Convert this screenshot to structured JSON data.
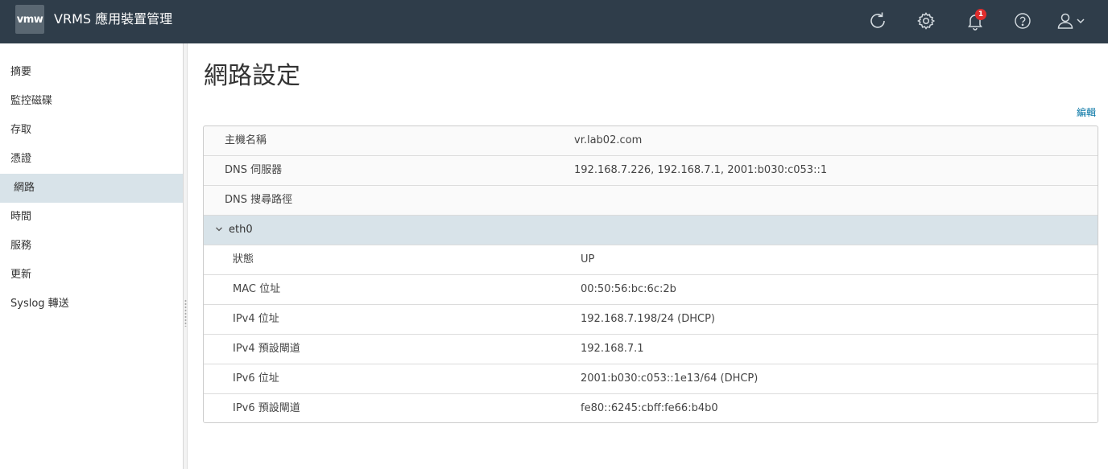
{
  "header": {
    "logo_text": "vmw",
    "title": "VRMS 應用裝置管理",
    "notification_count": "1",
    "icons": [
      "refresh-icon",
      "gear-icon",
      "bell-icon",
      "help-icon",
      "user-icon"
    ]
  },
  "sidebar": {
    "items": [
      {
        "label": "摘要"
      },
      {
        "label": "監控磁碟"
      },
      {
        "label": "存取"
      },
      {
        "label": "憑證"
      },
      {
        "label": "網路",
        "active": true
      },
      {
        "label": "時間"
      },
      {
        "label": "服務"
      },
      {
        "label": "更新"
      },
      {
        "label": "Syslog 轉送"
      }
    ]
  },
  "main": {
    "title": "網路設定",
    "edit_label": "編輯",
    "general": [
      {
        "key": "主機名稱",
        "value": "vr.lab02.com"
      },
      {
        "key": "DNS 伺服器",
        "value": "192.168.7.226, 192.168.7.1, 2001:b030:c053::1"
      },
      {
        "key": "DNS 搜尋路徑",
        "value": ""
      }
    ],
    "interface": {
      "name": "eth0",
      "rows": [
        {
          "key": "狀態",
          "value": "UP"
        },
        {
          "key": "MAC 位址",
          "value": "00:50:56:bc:6c:2b"
        },
        {
          "key": "IPv4 位址",
          "value": "192.168.7.198/24 (DHCP)"
        },
        {
          "key": "IPv4 預設閘道",
          "value": "192.168.7.1"
        },
        {
          "key": "IPv6 位址",
          "value": "2001:b030:c053::1e13/64 (DHCP)"
        },
        {
          "key": "IPv6 預設閘道",
          "value": "fe80::6245:cbff:fe66:b4b0"
        }
      ]
    }
  },
  "colors": {
    "header_bg": "#2f3d4a",
    "active_bg": "#d8e3e9",
    "link": "#0072a3",
    "badge": "#e02d2d"
  }
}
